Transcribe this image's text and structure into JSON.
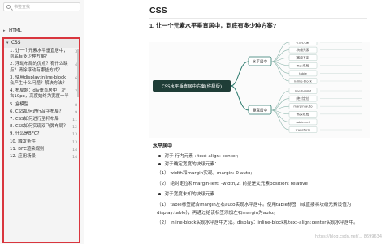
{
  "sidebar": {
    "search_placeholder": "书签查找",
    "top_item": "HTML",
    "top_item_caret": "▸",
    "css_label": "CSS",
    "css_caret": "▾",
    "items": [
      {
        "label": "1. 让一个元素水平垂直居中，到底有多少种方案?",
        "count": "3"
      },
      {
        "label": "2. 浮动布局的优点？有什么缺点？清除浮动有哪些方式？",
        "count": "4"
      },
      {
        "label": "3. 使用display:inline-block会产生什么问题？解决方法？",
        "count": "6"
      },
      {
        "label": "4. 布局题：div垂直居中，左右10px，高度始终为宽度一半",
        "count": "7"
      },
      {
        "label": "5. 盒模型",
        "count": "8"
      },
      {
        "label": "6. CSS如何进行品字布局？",
        "count": "9"
      },
      {
        "label": "7. CSS如何进行圣杯布局",
        "count": "11"
      },
      {
        "label": "8. CSS如何实现双飞翼布局？",
        "count": "12"
      },
      {
        "label": "9. 什么是BFC?",
        "count": "13"
      },
      {
        "label": "10. 触发条件",
        "count": "13"
      },
      {
        "label": "11. BFC渲染规则",
        "count": "14"
      },
      {
        "label": "12. 应用场景",
        "count": "14"
      }
    ]
  },
  "main": {
    "title": "CSS",
    "question": "1. 让一个元素水平垂直居中，到底有多少种方案?",
    "mindmap": {
      "center": "CSS水平垂直居中方案(终极版)",
      "branch_top": "水平居中",
      "branch_bottom": "垂直居中",
      "top_leaves": [
        "行内元素",
        "块级元素",
        "宽度不定",
        "flex布局",
        "table",
        "inline-block"
      ],
      "bottom_leaves": [
        "line-height",
        "绝对定位",
        "margin:auto",
        "flex布局",
        "table-cell",
        "transform"
      ]
    },
    "subheading": "水平居中",
    "lines": [
      {
        "bullet": true,
        "text": "对于 行内元素 : text-align: center;"
      },
      {
        "bullet": true,
        "text": "对于确定宽度的块级元素："
      },
      {
        "bullet": false,
        "text": "（1） width和margin实现。margin: 0 auto;"
      },
      {
        "bullet": false,
        "text": "（2） 绝对定位和margin-left: -width/2, 前提是父元素position: relative"
      },
      {
        "bullet": true,
        "text": "对于宽度未知的块级元素"
      },
      {
        "bullet": false,
        "text": "（1） table标签配合margin左右auto实现水平居中。使用table标签（或直接将块级元素设值为"
      },
      {
        "bullet": false,
        "text": "display:table），再通过给该标签添加左右margin为auto。"
      },
      {
        "bullet": false,
        "text": "（2） inline-block实现水平居中方法。display：inline-block和text-align:center实现水平居中。"
      }
    ],
    "watermark": "https://blog.csdn.net/... 8699634"
  }
}
